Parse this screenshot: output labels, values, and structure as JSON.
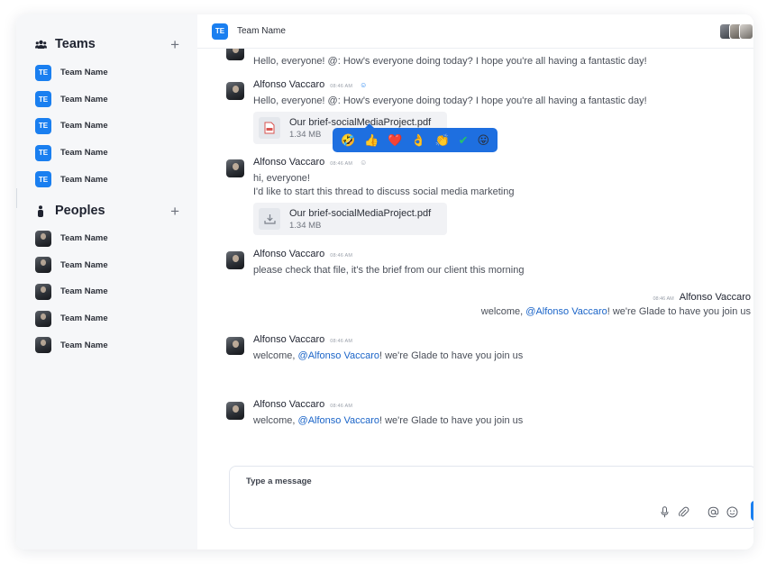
{
  "sidebar": {
    "teams": {
      "title": "Teams",
      "add_label": "+",
      "items": [
        {
          "badge": "TE",
          "label": "Team Name"
        },
        {
          "badge": "TE",
          "label": "Team Name"
        },
        {
          "badge": "TE",
          "label": "Team Name"
        },
        {
          "badge": "TE",
          "label": "Team Name"
        },
        {
          "badge": "TE",
          "label": "Team Name"
        }
      ]
    },
    "peoples": {
      "title": "Peoples",
      "add_label": "+",
      "items": [
        {
          "label": "Team Name"
        },
        {
          "label": "Team Name"
        },
        {
          "label": "Team Name"
        },
        {
          "label": "Team Name"
        },
        {
          "label": "Team Name"
        }
      ]
    }
  },
  "header": {
    "badge": "TE",
    "title": "Team Name"
  },
  "messages": [
    {
      "text": "Hello, everyone! @: How's everyone doing today? I hope you're all having a fantastic day!"
    },
    {
      "author": "Alfonso Vaccaro",
      "time": "08:46 AM",
      "text": "Hello, everyone! @: How's everyone doing today? I hope you're all having a fantastic day!",
      "file": {
        "name": "Our brief-socialMediaProject.pdf",
        "size": "1.34 MB"
      }
    },
    {
      "author": "Alfonso Vaccaro",
      "time": "08:46 AM",
      "line1": "hi, everyone!",
      "line2": "I'd like to start this thread to discuss social media marketing",
      "file": {
        "name": "Our brief-socialMediaProject.pdf",
        "size": "1.34 MB"
      }
    },
    {
      "author": "Alfonso Vaccaro",
      "time": "08:46 AM",
      "text": "please check that file, it's the brief from our client this morning"
    },
    {
      "author": "Alfonso Vaccaro",
      "time": "08:46 AM",
      "prefix": "welcome, ",
      "mention": "@Alfonso Vaccaro",
      "suffix": "! we're Glade to have you join us"
    },
    {
      "author": "Alfonso Vaccaro",
      "time": "08:46 AM",
      "prefix": "welcome, ",
      "mention": "@Alfonso Vaccaro",
      "suffix": "! we're Glade to have you join us"
    },
    {
      "author": "Alfonso Vaccaro",
      "time": "08:46 AM",
      "prefix": "welcome, ",
      "mention": "@Alfonso Vaccaro",
      "suffix": "! we're Glade to have you join us"
    }
  ],
  "reactions": [
    "🤣",
    "👍",
    "❤️",
    "👌",
    "👏",
    "✔",
    "😛"
  ],
  "composer": {
    "placeholder": "Type a message"
  },
  "colors": {
    "accent": "#1a7ff0",
    "picker": "#1e6fe0",
    "mention": "#1a64c8",
    "sidebar_bg": "#f6f7f9"
  },
  "icons": {
    "teams": "group-icon",
    "peoples": "person-icon",
    "file_pdf": "pdf-file-icon",
    "file_download": "download-icon",
    "mic": "microphone-icon",
    "attach": "paperclip-icon",
    "mention": "at-icon",
    "emoji": "smiley-icon"
  }
}
